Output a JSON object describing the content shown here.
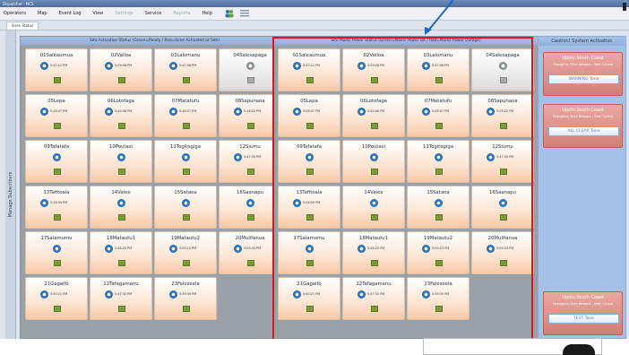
{
  "window": {
    "title": "Dispatcher - MCS"
  },
  "menu": {
    "items": [
      {
        "label": "Operators",
        "enabled": true
      },
      {
        "label": "Map",
        "enabled": true
      },
      {
        "label": "Event Log",
        "enabled": true
      },
      {
        "label": "View",
        "enabled": true
      },
      {
        "label": "Settings",
        "enabled": false
      },
      {
        "label": "Service",
        "enabled": true
      },
      {
        "label": "Reports",
        "enabled": false
      },
      {
        "label": "Help",
        "enabled": true
      }
    ]
  },
  "tab": {
    "label": "Siren Status"
  },
  "sidebar": {
    "label": "Manage Subscribers"
  },
  "left_panel": {
    "header": "Site Activation Status (Green=Ready / Red=Siren Activated at Site)",
    "tiles": [
      {
        "name": "01Saleaumua",
        "time": "5:47:12 PM"
      },
      {
        "name": "02Vailoa",
        "time": "5:09:08 PM"
      },
      {
        "name": "03Lalomanu",
        "time": "5:47:08 PM"
      },
      {
        "name": "04Salesapaga",
        "time": ""
      },
      {
        "name": "05Lepa",
        "time": "5:28:47 PM"
      },
      {
        "name": "06Lotofaga",
        "time": "5:45:08 PM"
      },
      {
        "name": "07Matatufu",
        "time": "5:48:07 PM"
      },
      {
        "name": "08Sapunaoa",
        "time": "5:26:22 PM"
      },
      {
        "name": "09Tafatafa",
        "time": ""
      },
      {
        "name": "10Poutasi",
        "time": ""
      },
      {
        "name": "11Togitogiga",
        "time": ""
      },
      {
        "name": "12Siumu",
        "time": "5:47:30 PM"
      },
      {
        "name": "13Tafitoala",
        "time": "5:26:59 PM"
      },
      {
        "name": "14Vaiee",
        "time": ""
      },
      {
        "name": "15Sataoa",
        "time": ""
      },
      {
        "name": "16Saanapu",
        "time": ""
      },
      {
        "name": "17Salamumu",
        "time": ""
      },
      {
        "name": "18Matautu1",
        "time": "5:48:20 PM"
      },
      {
        "name": "19Matautu2",
        "time": "5:09:15 PM"
      },
      {
        "name": "20Mulifanua",
        "time": "5:09:33 PM"
      },
      {
        "name": "21Gagaifo",
        "time": "5:40:21 PM"
      },
      {
        "name": "22Tafagamanu",
        "time": "5:47:32 PM"
      },
      {
        "name": "23Faleseela",
        "time": "5:39:39 PM"
      }
    ]
  },
  "right_panel": {
    "header": "Site Mains Power Status (Green=Mains Power OK / Red=Mains Power Outage)",
    "tiles": [
      {
        "name": "01Saleaumua",
        "time": "5:47:12 PM"
      },
      {
        "name": "02Vailoa",
        "time": "5:09:08 PM"
      },
      {
        "name": "03Lalomanu",
        "time": "5:47:08 PM"
      },
      {
        "name": "04Salesapaga",
        "time": ""
      },
      {
        "name": "05Lepa",
        "time": "5:28:47 PM"
      },
      {
        "name": "06Lotofaga",
        "time": "5:45:08 PM"
      },
      {
        "name": "07Matatufu",
        "time": "5:48:07 PM"
      },
      {
        "name": "08Sapunaoa",
        "time": "5:26:22 PM"
      },
      {
        "name": "09Tafatafa",
        "time": ""
      },
      {
        "name": "10Poutasi",
        "time": ""
      },
      {
        "name": "11Togitogiga",
        "time": ""
      },
      {
        "name": "12Siumu",
        "time": "5:47:30 PM"
      },
      {
        "name": "13Tafitoala",
        "time": "5:26:59 PM"
      },
      {
        "name": "14Vaiee",
        "time": ""
      },
      {
        "name": "15Sataoa",
        "time": ""
      },
      {
        "name": "16Saanapu",
        "time": ""
      },
      {
        "name": "17Salamumu",
        "time": ""
      },
      {
        "name": "18Matautu1",
        "time": "5:48:20 PM"
      },
      {
        "name": "19Matautu2",
        "time": "5:09:23 PM"
      },
      {
        "name": "20Mulifanua",
        "time": "5:09:33 PM"
      },
      {
        "name": "21Gagaifo",
        "time": "5:40:21 PM"
      },
      {
        "name": "22Tafagamanu",
        "time": "5:47:32 PM"
      },
      {
        "name": "23Faleseela",
        "time": "5:39:39 PM"
      }
    ]
  },
  "caution": {
    "header": "Caution! System Activation",
    "groups": [
      {
        "title": "Upolu South Coast",
        "subtitle": "Emergency Siren Network - Siren Control",
        "button": "WARNING Tone"
      },
      {
        "title": "Upolu South Coast",
        "subtitle": "Emergency Siren Network - Siren Control",
        "button": "ALL CLEAR Tone"
      },
      {
        "title": "Upolu South Coast",
        "subtitle": "Emergency Siren Network - Siren Control",
        "button": "TEST Tone"
      }
    ]
  },
  "colors": {
    "highlight": "#d01c1c",
    "tile_orange": "#f7c9a6",
    "status_green": "#7a9b3a",
    "arrow_blue": "#1d67c8"
  }
}
